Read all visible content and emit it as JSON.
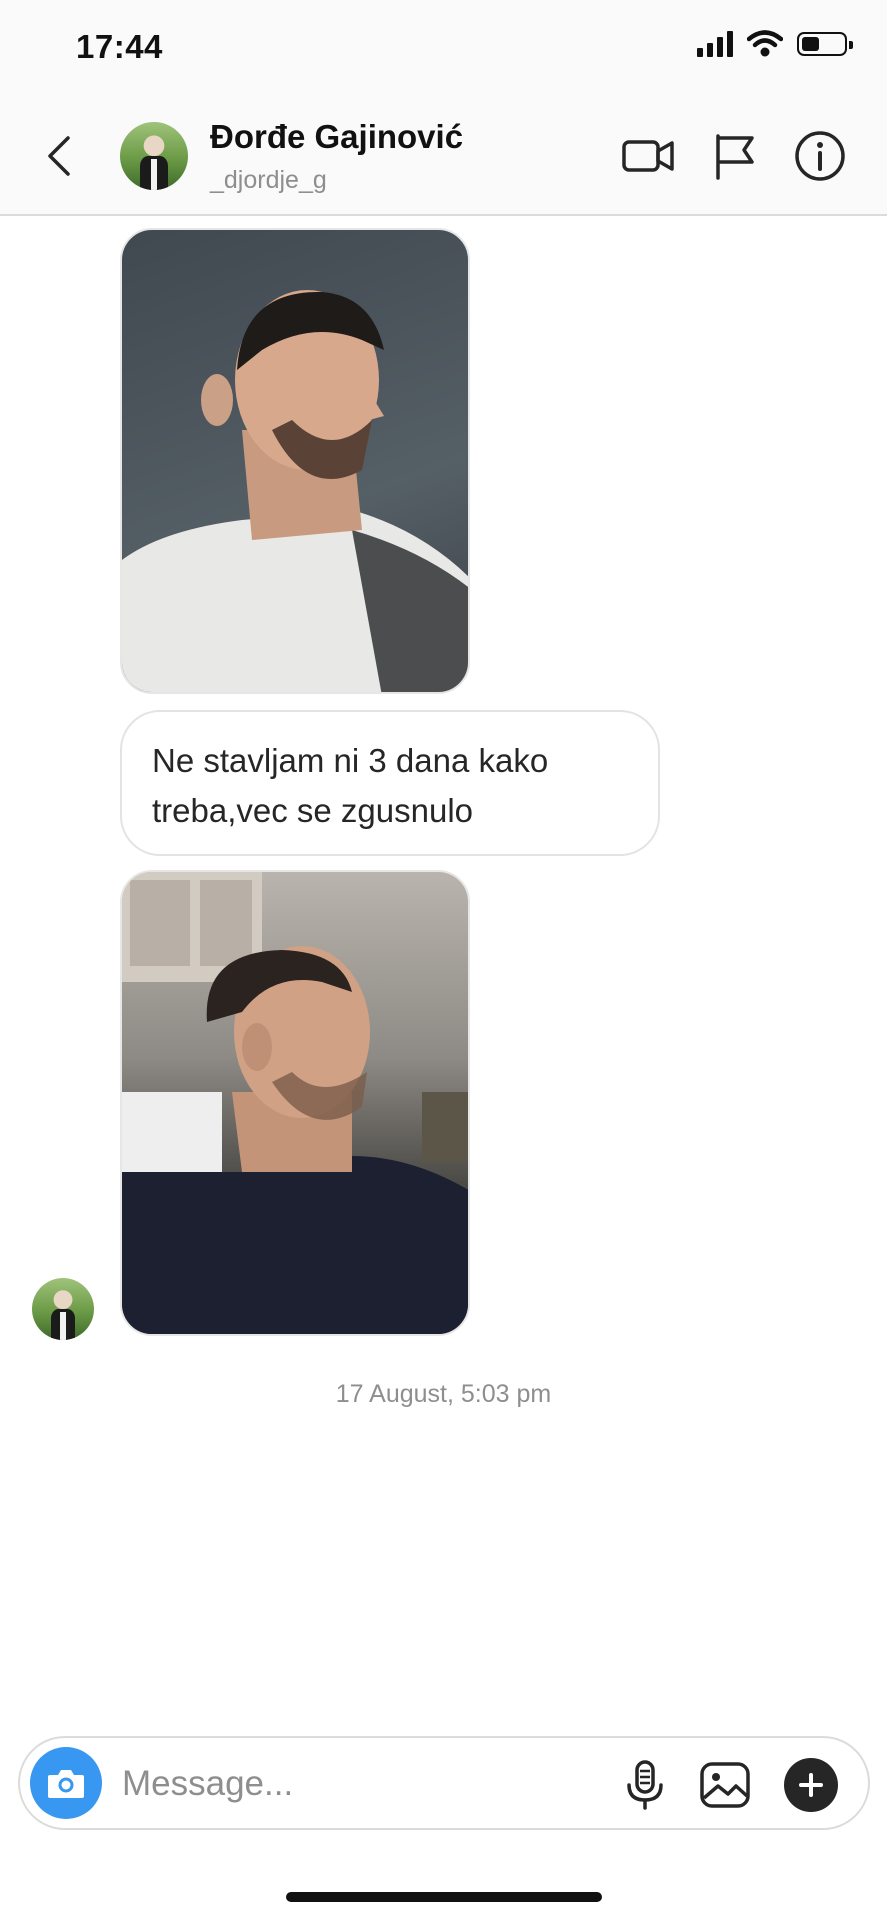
{
  "status_bar": {
    "time": "17:44",
    "icons": [
      "signal-icon",
      "wifi-icon",
      "battery-icon"
    ],
    "battery_level": 0.45
  },
  "header": {
    "name": "Đorđe Gajinović",
    "username": "_djordje_g",
    "icons": [
      "back-icon",
      "video-call-icon",
      "flag-icon",
      "info-icon"
    ]
  },
  "messages": [
    {
      "type": "photo",
      "subject": "profile-side-view-1"
    },
    {
      "type": "text",
      "text": "Ne stavljam ni 3 dana kako treba,vec se zgusnulo"
    },
    {
      "type": "photo",
      "subject": "profile-side-view-2"
    }
  ],
  "timestamp": "17 August, 5:03 pm",
  "composer": {
    "placeholder": "Message...",
    "icons": [
      "camera-icon",
      "microphone-icon",
      "gallery-icon",
      "plus-icon"
    ]
  },
  "colors": {
    "accent": "#3897f0",
    "text": "#262626",
    "muted": "#8e8e8e",
    "border": "#dbdbdb"
  }
}
